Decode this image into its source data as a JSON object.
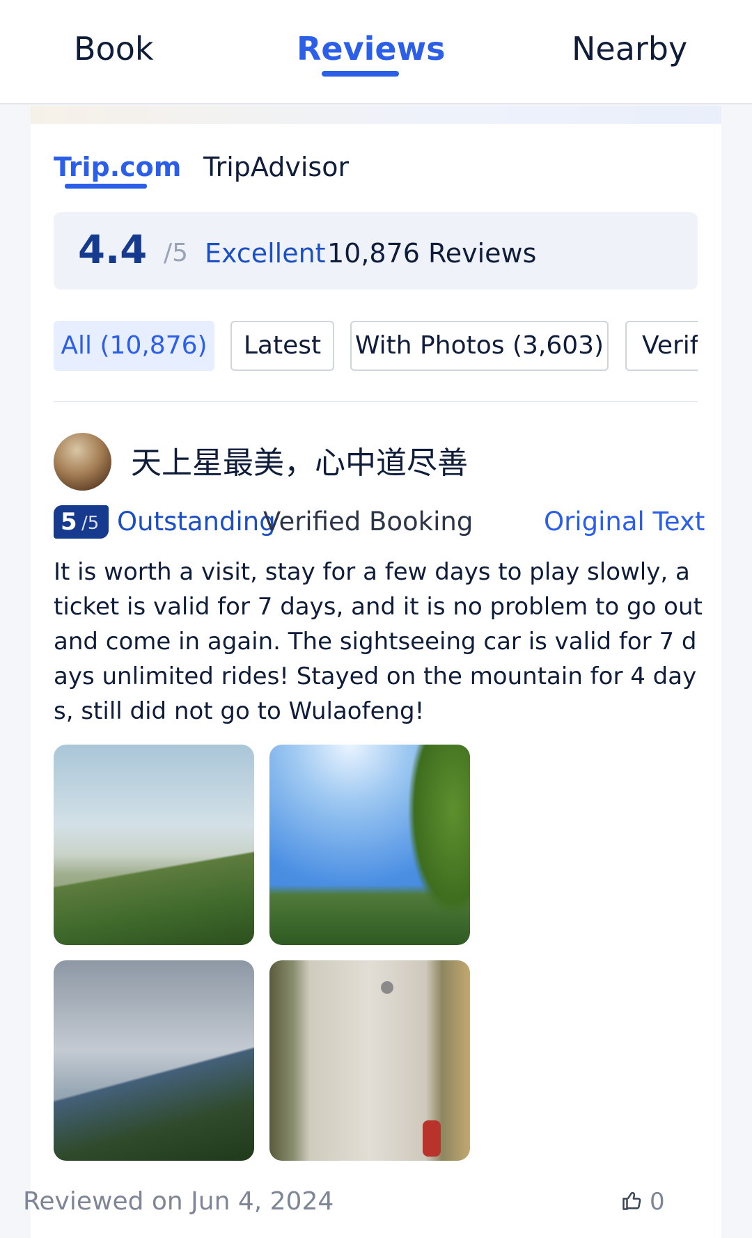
{
  "top_tabs": [
    {
      "label": "Book"
    },
    {
      "label": "Reviews",
      "active": true
    },
    {
      "label": "Nearby"
    }
  ],
  "source_tabs": [
    {
      "label": "Trip.com",
      "active": true
    },
    {
      "label": "TripAdvisor"
    }
  ],
  "summary": {
    "score": "4.4",
    "out_of": "/5",
    "label": "Excellent",
    "count": "10,876 Reviews"
  },
  "filters": [
    {
      "label": "All (10,876)",
      "active": true
    },
    {
      "label": "Latest"
    },
    {
      "label": "With Photos (3,603)"
    },
    {
      "label": "Verifi"
    }
  ],
  "review": {
    "username": "天上星最美，心中道尽善",
    "rating": "5",
    "rating_out_of": "/5",
    "rating_label": "Outstanding",
    "verified": "Verified Booking",
    "original_text_link": "Original Text",
    "text": "It is worth a visit, stay for a few days to play slowly, a ticket is valid for 7 days, and it is no problem to go out and come in again. The sightseeing car is valid for 7 days unlimited rides! Stayed on the mountain for 4 days, still did not go to Wulaofeng!",
    "photo_count": 4,
    "reviewed_on": "Reviewed on Jun 4, 2024",
    "likes": "0"
  },
  "colors": {
    "accent": "#2c5fe8",
    "rating_dark": "#163a8e",
    "muted": "#7d8596"
  },
  "icons": {
    "like": "thumbs-up-icon"
  }
}
